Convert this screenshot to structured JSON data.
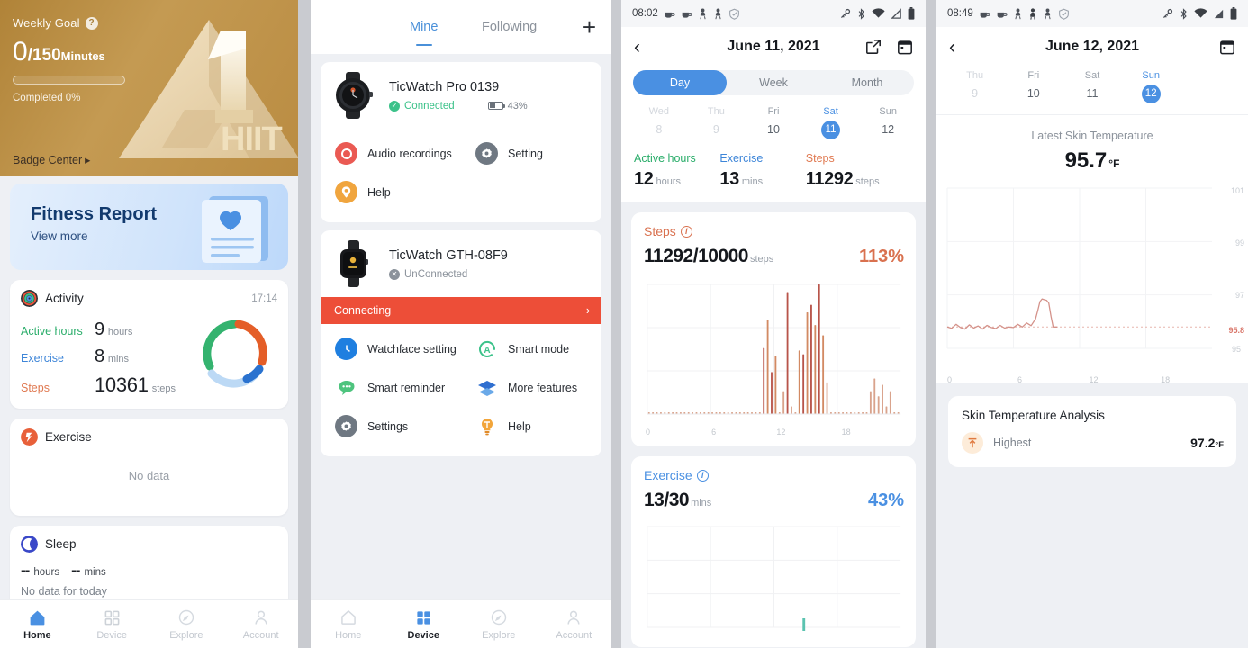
{
  "panel1": {
    "hero": {
      "weekly_goal_label": "Weekly Goal",
      "help_icon": "question-icon",
      "value_current": "0",
      "value_target": "/150",
      "value_unit": "Minutes",
      "completed": "Completed 0%",
      "badge_center": "Badge Center",
      "badge_art_text": "HIIT",
      "badge_art_number": "1"
    },
    "fitness": {
      "title": "Fitness Report",
      "subtitle": "View more"
    },
    "activity": {
      "title": "Activity",
      "icon": "activity-rings-icon",
      "time": "17:14",
      "rows": [
        {
          "label": "Active hours",
          "value": "9",
          "unit": "hours",
          "color": "#2aad6a"
        },
        {
          "label": "Exercise",
          "value": "8",
          "unit": "mins",
          "color": "#3d85d8"
        },
        {
          "label": "Steps",
          "value": "10361",
          "unit": "steps",
          "color": "#e07a52"
        }
      ]
    },
    "exercise": {
      "title": "Exercise",
      "icon": "exercise-icon",
      "empty": "No data"
    },
    "sleep": {
      "title": "Sleep",
      "icon": "sleep-moon-icon",
      "hours": "--",
      "hours_unit": "hours",
      "mins": "--",
      "mins_unit": "mins",
      "empty": "No data for today"
    },
    "nav": [
      {
        "label": "Home",
        "icon": "home-icon",
        "active": true
      },
      {
        "label": "Device",
        "icon": "grid-icon",
        "active": false
      },
      {
        "label": "Explore",
        "icon": "compass-icon",
        "active": false
      },
      {
        "label": "Account",
        "icon": "person-icon",
        "active": false
      }
    ]
  },
  "panel2": {
    "tabs": [
      {
        "label": "Mine",
        "active": true
      },
      {
        "label": "Following",
        "active": false
      }
    ],
    "add_button": "+",
    "devices": [
      {
        "name": "TicWatch Pro 0139",
        "status": "Connected",
        "status_state": "connected",
        "battery": "43%",
        "items": [
          {
            "label": "Audio recordings",
            "icon": "record-circle-icon",
            "color": "#ea5a53"
          },
          {
            "label": "Setting",
            "icon": "gear-icon",
            "color": "#6f7882"
          },
          {
            "label": "Help",
            "icon": "help-pin-icon",
            "color": "#f0a53e"
          }
        ]
      },
      {
        "name": "TicWatch GTH-08F9",
        "status": "UnConnected",
        "status_state": "unconnected",
        "banner": "Connecting",
        "banner_color": "#ed4e38",
        "items": [
          {
            "label": "Watchface setting",
            "icon": "clock-icon",
            "color": "#1f7fe0"
          },
          {
            "label": "Smart mode",
            "icon": "smart-mode-icon",
            "color": "#3cc28a"
          },
          {
            "label": "Smart reminder",
            "icon": "chat-bubble-icon",
            "color": "#4ec47e"
          },
          {
            "label": "More features",
            "icon": "layers-icon",
            "color": "#2f6fd0"
          },
          {
            "label": "Settings",
            "icon": "gear-icon",
            "color": "#6f7882"
          },
          {
            "label": "Help",
            "icon": "bulb-icon",
            "color": "#f2a53a"
          }
        ]
      }
    ],
    "nav": [
      {
        "label": "Home",
        "icon": "home-icon",
        "active": false
      },
      {
        "label": "Device",
        "icon": "grid-icon",
        "active": true
      },
      {
        "label": "Explore",
        "icon": "compass-icon",
        "active": false
      },
      {
        "label": "Account",
        "icon": "person-icon",
        "active": false
      }
    ]
  },
  "panel3": {
    "statusbar": {
      "time": "08:02",
      "icons": [
        "coffee-icon",
        "coffee-icon",
        "person-icon",
        "person-icon",
        "shield-icon"
      ],
      "right_icons": [
        "key-icon",
        "bluetooth-icon",
        "wifi-icon",
        "signal-icon",
        "battery-icon"
      ]
    },
    "header": {
      "title": "June 11, 2021",
      "back_icon": "chevron-left-icon",
      "share_icon": "share-icon",
      "calendar_icon": "calendar-icon"
    },
    "segments": [
      {
        "label": "Day",
        "active": true
      },
      {
        "label": "Week",
        "active": false
      },
      {
        "label": "Month",
        "active": false
      }
    ],
    "days": [
      {
        "name": "Wed",
        "date": "8",
        "dim": true,
        "selected": false
      },
      {
        "name": "Thu",
        "date": "9",
        "dim": true,
        "selected": false
      },
      {
        "name": "Fri",
        "date": "10",
        "dim": false,
        "selected": false
      },
      {
        "name": "Sat",
        "date": "11",
        "dim": false,
        "selected": true
      },
      {
        "name": "Sun",
        "date": "12",
        "dim": false,
        "selected": false
      }
    ],
    "summary": [
      {
        "label": "Active hours",
        "value": "12",
        "unit": "hours",
        "color": "#2aad6a"
      },
      {
        "label": "Exercise",
        "value": "13",
        "unit": "mins",
        "color": "#3d85d8"
      },
      {
        "label": "Steps",
        "value": "11292",
        "unit": "steps",
        "color": "#e07a52"
      }
    ],
    "steps_card": {
      "title": "Steps",
      "info_icon": "info-icon",
      "value": "11292/10000",
      "unit": "steps",
      "percent": "113%"
    },
    "exercise_card": {
      "title": "Exercise",
      "info_icon": "info-icon",
      "value": "13/30",
      "unit": "mins",
      "percent": "43%"
    }
  },
  "panel4": {
    "statusbar": {
      "time": "08:49",
      "icons": [
        "coffee-icon",
        "coffee-icon",
        "person-icon",
        "person-icon",
        "person-icon",
        "shield-icon"
      ],
      "right_icons": [
        "key-icon",
        "bluetooth-icon",
        "wifi-icon",
        "signal-icon",
        "battery-icon"
      ]
    },
    "header": {
      "title": "June 12, 2021",
      "back_icon": "chevron-left-icon",
      "calendar_icon": "calendar-icon"
    },
    "days": [
      {
        "name": "Thu",
        "date": "9",
        "dim": true,
        "selected": false
      },
      {
        "name": "Fri",
        "date": "10",
        "dim": false,
        "selected": false
      },
      {
        "name": "Sat",
        "date": "11",
        "dim": false,
        "selected": false
      },
      {
        "name": "Sun",
        "date": "12",
        "dim": false,
        "selected": true
      }
    ],
    "latest": {
      "label": "Latest Skin Temperature",
      "value": "95.7",
      "unit": "°F"
    },
    "analysis": {
      "title": "Skin Temperature Analysis",
      "row_label": "Highest",
      "row_icon": "arrow-up-temp-icon",
      "row_value": "97.2",
      "row_unit": "°F"
    }
  },
  "chart_data": [
    {
      "type": "bar",
      "title": "Steps",
      "xlabel": "hour",
      "ylabel": "steps",
      "xticks": [
        "0",
        "6",
        "12",
        "18"
      ],
      "xlim": [
        0,
        24
      ],
      "ylim": [
        0,
        1200
      ],
      "grid": true,
      "color": "#d07a5a",
      "x": [
        0,
        0.5,
        1,
        1.5,
        2,
        2.5,
        3,
        3.5,
        4,
        4.5,
        5,
        5.5,
        6,
        6.5,
        7,
        7.5,
        8,
        8.5,
        9,
        9.5,
        10,
        10.5,
        11,
        11.5,
        12,
        12.5,
        13,
        13.5,
        14,
        14.5,
        15,
        15.5,
        16,
        16.5,
        17,
        17.5,
        18,
        18.5,
        19,
        19.5,
        20,
        20.5,
        21,
        21.5,
        22,
        22.5,
        23,
        23.5
      ],
      "values": [
        4,
        4,
        4,
        4,
        4,
        4,
        4,
        4,
        4,
        4,
        4,
        4,
        4,
        4,
        8,
        8,
        8,
        8,
        8,
        8,
        8,
        8,
        8,
        8,
        8,
        8,
        8,
        8,
        8,
        520,
        740,
        330,
        460,
        4,
        180,
        960,
        60,
        6,
        500,
        470,
        800,
        860,
        700,
        1020,
        620,
        250,
        6,
        6,
        6,
        6,
        6,
        6,
        6,
        6,
        6,
        6,
        180,
        280,
        140,
        230,
        60,
        180,
        6,
        6
      ]
    },
    {
      "type": "bar",
      "title": "Exercise",
      "xlabel": "hour",
      "ylabel": "mins",
      "xticks": [],
      "grid": true,
      "color": "#5bc3b0",
      "values": []
    },
    {
      "type": "line",
      "title": "Skin Temperature",
      "xlabel": "hour",
      "ylabel": "°F",
      "xticks": [
        "0",
        "6",
        "12",
        "18"
      ],
      "yticks": [
        "101",
        "99",
        "97",
        "95.8",
        "95"
      ],
      "ylim": [
        95,
        101
      ],
      "xlim": [
        0,
        24
      ],
      "grid": true,
      "color": "#d9a19a",
      "baseline": 95.8,
      "series": [
        {
          "name": "Skin Temperature",
          "x": [
            0,
            0.4,
            0.8,
            1.2,
            1.6,
            2,
            2.4,
            2.8,
            3.2,
            3.6,
            4,
            4.4,
            4.8,
            5.2,
            5.6,
            6,
            6.4,
            6.8,
            7.2,
            7.6,
            8,
            8.2,
            8.4,
            8.6,
            8.8,
            9,
            9.2,
            9.4,
            9.6,
            9.8,
            10
          ],
          "values": [
            95.8,
            95.75,
            95.9,
            95.78,
            95.72,
            95.88,
            95.76,
            95.84,
            95.72,
            95.86,
            95.78,
            95.74,
            95.86,
            95.76,
            95.8,
            95.78,
            95.9,
            95.8,
            95.95,
            95.85,
            96.1,
            96.4,
            96.75,
            96.85,
            96.82,
            96.8,
            96.7,
            96.2,
            95.8,
            95.8,
            95.8
          ]
        }
      ]
    }
  ]
}
